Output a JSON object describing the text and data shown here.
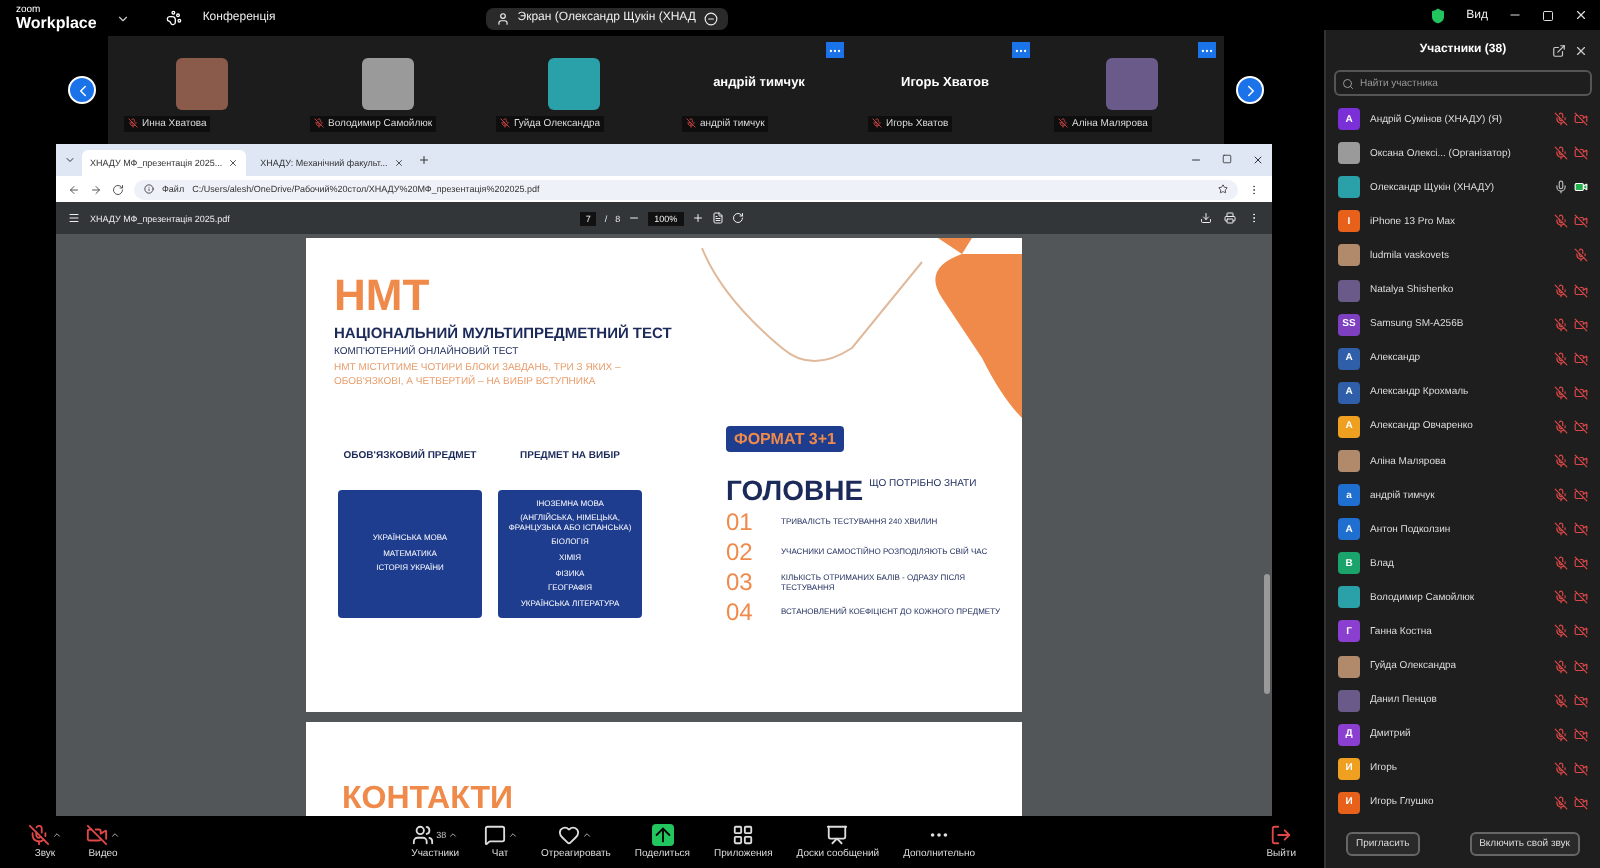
{
  "app": {
    "logo_top": "zoom",
    "logo_bottom": "Workplace",
    "meeting_label": "Конференція",
    "share_label": "Экран (Олександр Щукін (ХНАД",
    "view_label": "Вид"
  },
  "thumbnails": [
    {
      "name": "Инна Хватова",
      "kind": "photo",
      "menu_shown": false
    },
    {
      "name": "Володимир Самойлюк",
      "kind": "photo",
      "menu_shown": false
    },
    {
      "name": "Гуйда Олександра",
      "kind": "photo",
      "menu_shown": false
    },
    {
      "name": "андрій тимчук",
      "kind": "name",
      "display_name": "андрій тимчук",
      "menu_shown": true
    },
    {
      "name": "Игорь Хватов",
      "kind": "name",
      "display_name": "Игорь Хватов",
      "menu_shown": true
    },
    {
      "name": "Аліна Малярова",
      "kind": "photo",
      "menu_shown": true
    }
  ],
  "browser": {
    "tabs": [
      {
        "label": "ХНАДУ МФ_презентація 2025...",
        "selected": true
      },
      {
        "label": "ХНАДУ: Механічний факульт...",
        "selected": false
      }
    ],
    "address_prefix": "Файл",
    "address": "C:/Users/alesh/OneDrive/Рабочий%20стол/ХНАДУ%20МФ_презентація%202025.pdf",
    "pdf": {
      "title": "ХНАДУ МФ_презентація 2025.pdf",
      "page": "7",
      "separator": "/",
      "pages": "8",
      "zoom": "100%"
    }
  },
  "slide": {
    "title": "НМТ",
    "subtitle": "НАЦІОНАЛЬНИЙ МУЛЬТИПРЕДМЕТНИЙ ТЕСТ",
    "kind_line": "КОМП'ЮТЕРНИЙ ОНЛАЙНОВИЙ ТЕСТ",
    "description": "НМТ МІСТИТИМЕ ЧОТИРИ БЛОКИ ЗАВДАНЬ, ТРИ З ЯКИХ – ОБОВ'ЯЗКОВІ, А ЧЕТВЕРТИЙ – НА ВИБІР ВСТУПНИКА",
    "blocks": [
      {
        "heading": "ОБОВ'ЯЗКОВИЙ ПРЕДМЕТ",
        "items": [
          "УКРАЇНСЬКА МОВА",
          "МАТЕМАТИКА",
          "ІСТОРІЯ УКРАЇНИ"
        ]
      },
      {
        "heading": "ПРЕДМЕТ НА ВИБІР",
        "items": [
          "ІНОЗЕМНА МОВА",
          "(АНГЛІЙСЬКА, НІМЕЦЬКА, ФРАНЦУЗЬКА АБО ІСПАНСЬКА)",
          "БІОЛОГІЯ",
          "ХІМІЯ",
          "ФІЗИКА",
          "ГЕОГРАФІЯ",
          "УКРАЇНСЬКА ЛІТЕРАТУРА"
        ]
      }
    ],
    "format_badge": "ФОРМАТ 3+1",
    "main_heading": "ГОЛОВНЕ",
    "main_subheading": "ЩО ПОТРІБНО ЗНАТИ",
    "points": [
      {
        "number": "01",
        "text": "ТРИВАЛІСТЬ ТЕСТУВАННЯ 240 ХВИЛИН"
      },
      {
        "number": "02",
        "text": "УЧАСНИКИ САМОСТІЙНО РОЗПОДІЛЯЮТЬ СВІЙ ЧАС"
      },
      {
        "number": "03",
        "text": "КІЛЬКІСТЬ ОТРИМАНИХ БАЛІВ - ОДРАЗУ ПІСЛЯ ТЕСТУВАННЯ"
      },
      {
        "number": "04",
        "text": "ВСТАНОВЛЕНИЙ КОЕФІЦІЄНТ ДО КОЖНОГО ПРЕДМЕТУ"
      }
    ]
  },
  "next_slide_title": "КОНТАКТИ",
  "participants_panel": {
    "title": "Участники (38)",
    "search_placeholder": "Найти участника",
    "participants": [
      {
        "name": "Андрій Сумінов (ХНАДУ) (Я)",
        "initial": "A",
        "color": "#7b2fd6",
        "mic_muted": true,
        "video_on": false
      },
      {
        "name": "Оксана Олексі... (Організатор)",
        "mic_muted": true,
        "video_on": false
      },
      {
        "name": "Олександр Щукін (ХНАДУ)",
        "mic_muted": false,
        "video_on": true
      },
      {
        "name": "iPhone 13 Pro Max",
        "initial": "I",
        "color": "#e8611a",
        "mic_muted": true,
        "video_on": false
      },
      {
        "name": "ludmila vaskovets",
        "mic_muted": true
      },
      {
        "name": "Natalya Shishenko",
        "mic_muted": true,
        "video_on": false
      },
      {
        "name": "Samsung SM-A256B",
        "initial": "SS",
        "color": "#7e3fc1",
        "mic_muted": true,
        "video_on": false
      },
      {
        "name": "Александр",
        "initial": "A",
        "color": "#2f5fa8",
        "mic_muted": true,
        "video_on": false
      },
      {
        "name": "Александр Кроxмаль",
        "initial": "A",
        "color": "#2f5fa8",
        "mic_muted": true,
        "video_on": false
      },
      {
        "name": "Александр Овчаренко",
        "initial": "A",
        "color": "#f0a020",
        "mic_muted": true,
        "video_on": false
      },
      {
        "name": "Аліна Малярова",
        "mic_muted": true,
        "video_on": false
      },
      {
        "name": "андрій тимчук",
        "initial": "а",
        "color": "#1f6fd0",
        "mic_muted": true,
        "video_on": false
      },
      {
        "name": "Антон Подколзин",
        "initial": "A",
        "color": "#1f6fd0",
        "mic_muted": true,
        "video_on": false
      },
      {
        "name": "Влад",
        "initial": "В",
        "color": "#1aa36b",
        "mic_muted": true,
        "video_on": false
      },
      {
        "name": "Володимир Самойлюк",
        "mic_muted": true,
        "video_on": false
      },
      {
        "name": "Ганна Костна",
        "initial": "Г",
        "color": "#8a3fd0",
        "mic_muted": true,
        "video_on": false
      },
      {
        "name": "Гуйда Олександра",
        "mic_muted": true,
        "video_on": false
      },
      {
        "name": "Данил Пенцов",
        "mic_muted": true,
        "video_on": false
      },
      {
        "name": "Дмитрий",
        "initial": "Д",
        "color": "#8a3fd0",
        "mic_muted": true,
        "video_on": false
      },
      {
        "name": "Игорь",
        "initial": "И",
        "color": "#f0a020",
        "mic_muted": true,
        "video_on": false
      },
      {
        "name": "Игорь Глушко",
        "initial": "И",
        "color": "#e8611a",
        "mic_muted": true,
        "video_on": false
      }
    ],
    "buttons": [
      "Пригласить",
      "Включить свой звук"
    ]
  },
  "toolbar": [
    {
      "kind": "audio",
      "label": "Звук"
    },
    {
      "kind": "video",
      "label": "Видео"
    },
    {
      "kind": "participants",
      "label": "Участники",
      "count": "38"
    },
    {
      "kind": "chat",
      "label": "Чат"
    },
    {
      "kind": "react",
      "label": "Отреагировать"
    },
    {
      "kind": "share",
      "label": "Поделиться"
    },
    {
      "kind": "apps",
      "label": "Приложения"
    },
    {
      "kind": "boards",
      "label": "Доски сообщений"
    },
    {
      "kind": "more",
      "label": "Дополнительно"
    },
    {
      "kind": "leave",
      "label": "Выйти"
    }
  ]
}
